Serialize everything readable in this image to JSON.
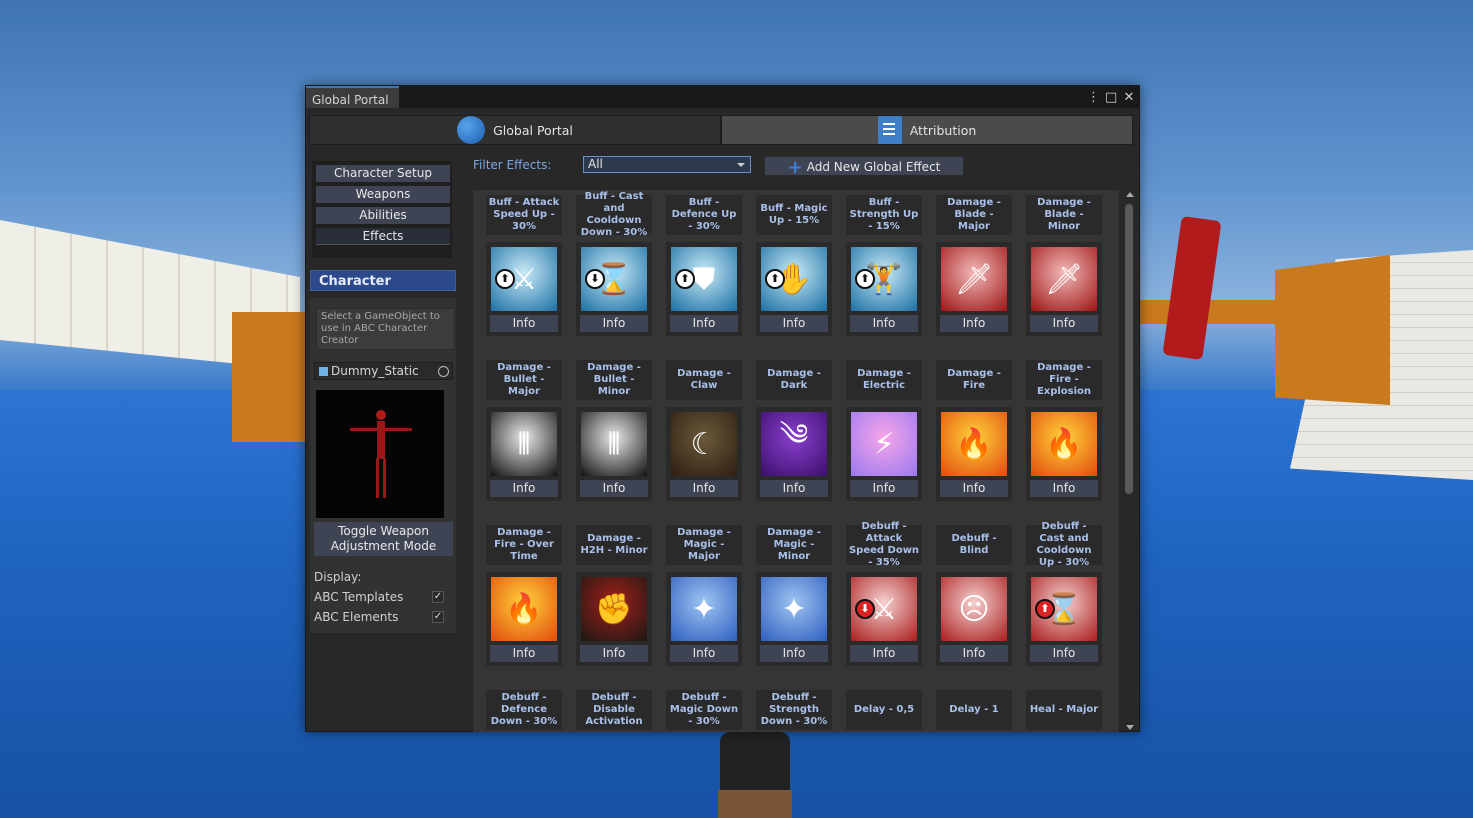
{
  "window": {
    "tab_title": "Global Portal",
    "controls": [
      "⋮",
      "□",
      "✕"
    ]
  },
  "top_tabs": {
    "global_portal": "Global Portal",
    "attribution": "Attribution"
  },
  "nav": {
    "items": [
      "Character Setup",
      "Weapons",
      "Abilities",
      "Effects"
    ],
    "selected": "Effects"
  },
  "character": {
    "header": "Character",
    "hint": "Select a GameObject to use in ABC Character Creator",
    "object_name": "Dummy_Static",
    "toggle_button": "Toggle Weapon Adjustment Mode",
    "display_label": "Display:",
    "checkboxes": [
      {
        "label": "ABC Templates",
        "checked": true
      },
      {
        "label": "ABC Elements",
        "checked": true
      }
    ]
  },
  "filter": {
    "label": "Filter Effects:",
    "selected": "All",
    "add_button": "Add New Global Effect"
  },
  "effects": [
    {
      "name": "Buff - Attack Speed Up - 30%",
      "icon": "swords-cheer-icon",
      "colors": [
        "#c9eaf7",
        "#1b6fa3"
      ],
      "glyph": "⚔",
      "badge": "up"
    },
    {
      "name": "Buff - Cast and Cooldown Down - 30%",
      "icon": "hourglass-icon",
      "colors": [
        "#c9eaf7",
        "#1b6fa3"
      ],
      "glyph": "⌛",
      "badge": "down"
    },
    {
      "name": "Buff - Defence Up - 30%",
      "icon": "shield-icon",
      "colors": [
        "#c9eaf7",
        "#1b6fa3"
      ],
      "glyph": "⛊",
      "badge": "up"
    },
    {
      "name": "Buff - Magic Up - 15%",
      "icon": "magic-hand-icon",
      "colors": [
        "#c9eaf7",
        "#1b6fa3"
      ],
      "glyph": "✋",
      "badge": "up"
    },
    {
      "name": "Buff - Strength Up - 15%",
      "icon": "weightlifter-icon",
      "colors": [
        "#c9eaf7",
        "#1b6fa3"
      ],
      "glyph": "🏋",
      "badge": "up"
    },
    {
      "name": "Damage - Blade - Major",
      "icon": "blade-icon",
      "colors": [
        "#f2b8b8",
        "#9e1414"
      ],
      "glyph": "🗡",
      "badge": ""
    },
    {
      "name": "Damage - Blade - Minor",
      "icon": "blade-icon",
      "colors": [
        "#f2b8b8",
        "#9e1414"
      ],
      "glyph": "🗡",
      "badge": ""
    },
    {
      "name": "Damage - Bullet - Major",
      "icon": "bullet-icon",
      "colors": [
        "#e9e9e9",
        "#111111"
      ],
      "glyph": "⦀",
      "badge": ""
    },
    {
      "name": "Damage - Bullet - Minor",
      "icon": "bullet-icon",
      "colors": [
        "#e9e9e9",
        "#111111"
      ],
      "glyph": "⦀",
      "badge": ""
    },
    {
      "name": "Damage - Claw",
      "icon": "claw-icon",
      "colors": [
        "#6b5a3a",
        "#2d1e12"
      ],
      "glyph": "☾",
      "badge": ""
    },
    {
      "name": "Damage - Dark",
      "icon": "dark-swirl-icon",
      "colors": [
        "#8a3fcf",
        "#3b0f6b"
      ],
      "glyph": "༄",
      "badge": ""
    },
    {
      "name": "Damage - Electric",
      "icon": "lightning-icon",
      "colors": [
        "#f6a6e8",
        "#9a78f0"
      ],
      "glyph": "⚡",
      "badge": ""
    },
    {
      "name": "Damage - Fire",
      "icon": "fire-icon",
      "colors": [
        "#ffd23a",
        "#e24b0d"
      ],
      "glyph": "🔥",
      "badge": ""
    },
    {
      "name": "Damage - Fire - Explosion",
      "icon": "fire-icon",
      "colors": [
        "#ffd23a",
        "#e24b0d"
      ],
      "glyph": "🔥",
      "badge": ""
    },
    {
      "name": "Damage - Fire - Over Time",
      "icon": "fire-icon",
      "colors": [
        "#ffd23a",
        "#e24b0d"
      ],
      "glyph": "🔥",
      "badge": ""
    },
    {
      "name": "Damage - H2H - Minor",
      "icon": "punch-icon",
      "colors": [
        "#a3201a",
        "#1c1714"
      ],
      "glyph": "✊",
      "badge": ""
    },
    {
      "name": "Damage - Magic - Major",
      "icon": "sparkles-icon",
      "colors": [
        "#9fc4f2",
        "#2e5fbf"
      ],
      "glyph": "✦",
      "badge": ""
    },
    {
      "name": "Damage - Magic - Minor",
      "icon": "sparkles-icon",
      "colors": [
        "#9fc4f2",
        "#2e5fbf"
      ],
      "glyph": "✦",
      "badge": ""
    },
    {
      "name": "Debuff - Attack Speed Down - 35%",
      "icon": "swords-cheer-icon",
      "colors": [
        "#f6d0d0",
        "#a91d1d"
      ],
      "glyph": "⚔",
      "badge": "down"
    },
    {
      "name": "Debuff - Blind",
      "icon": "blindfold-icon",
      "colors": [
        "#f6d0d0",
        "#a91d1d"
      ],
      "glyph": "☹",
      "badge": ""
    },
    {
      "name": "Debuff - Cast and Cooldown Up - 30%",
      "icon": "hourglass-icon",
      "colors": [
        "#f6d0d0",
        "#a91d1d"
      ],
      "glyph": "⌛",
      "badge": "up"
    },
    {
      "name": "Debuff - Defence Down - 30%",
      "icon": "",
      "colors": [],
      "glyph": "",
      "badge": ""
    },
    {
      "name": "Debuff - Disable Activation",
      "icon": "",
      "colors": [],
      "glyph": "",
      "badge": ""
    },
    {
      "name": "Debuff - Magic Down - 30%",
      "icon": "",
      "colors": [],
      "glyph": "",
      "badge": ""
    },
    {
      "name": "Debuff - Strength Down - 30%",
      "icon": "",
      "colors": [],
      "glyph": "",
      "badge": ""
    },
    {
      "name": "Delay - 0,5",
      "icon": "",
      "colors": [],
      "glyph": "",
      "badge": ""
    },
    {
      "name": "Delay - 1",
      "icon": "",
      "colors": [],
      "glyph": "",
      "badge": ""
    },
    {
      "name": "Heal - Major",
      "icon": "",
      "colors": [],
      "glyph": "",
      "badge": ""
    }
  ],
  "info_label": "Info"
}
